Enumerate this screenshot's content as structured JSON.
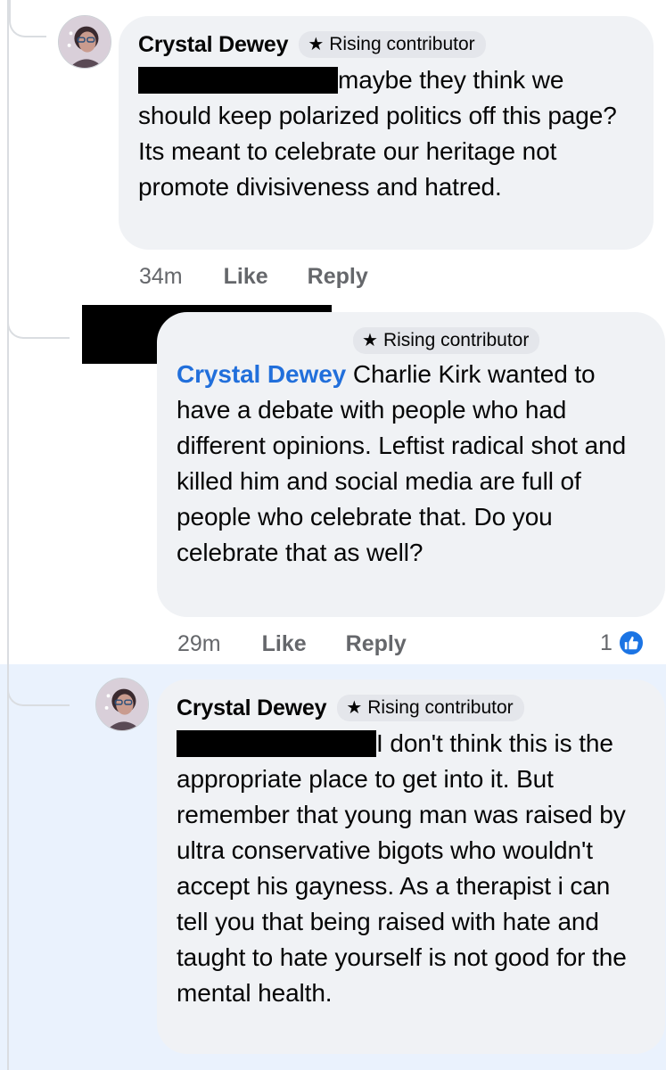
{
  "badge_label": "Rising contributor",
  "action_like": "Like",
  "action_reply": "Reply",
  "comments": [
    {
      "author": "Crystal Dewey",
      "text": "maybe they think we should keep polarized politics off this page? Its meant to celebrate our heritage not promote divisiveness and hatred.",
      "time": "34m"
    },
    {
      "author": "",
      "mention": "Crystal Dewey",
      "text": " Charlie Kirk wanted to have a debate with people who had different opinions. Leftist radical shot and killed him and social media are full of people who celebrate that. Do you celebrate that as well?",
      "time": "29m",
      "reaction_count": "1"
    },
    {
      "author": "Crystal Dewey",
      "text": "I don't think this is the appropriate place to get into it. But remember that young man was raised by ultra conservative bigots who wouldn't accept his gayness. As a therapist i can tell you that being raised with hate and taught to hate yourself is not good for the mental health."
    }
  ],
  "colors": {
    "bubble": "#f0f2f5",
    "mention": "#216fdb",
    "highlight": "#eaf2fd",
    "like_blue": "#1b74e4"
  },
  "icons": [
    "star-icon",
    "like-thumb-icon",
    "avatar-image"
  ]
}
